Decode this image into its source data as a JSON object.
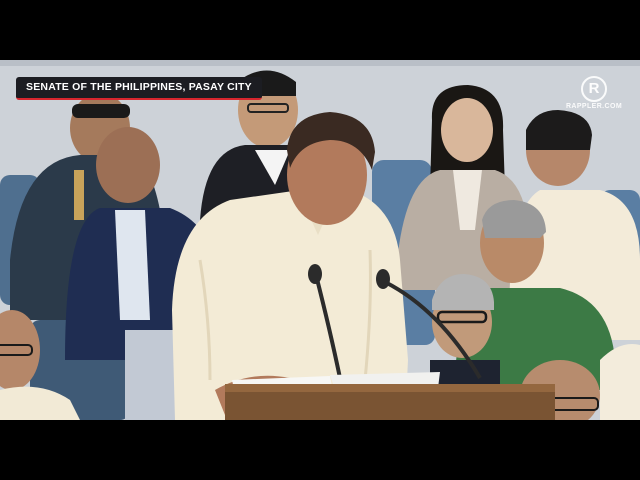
{
  "caption": {
    "location": "SENATE OF THE PHILIPPINES, PASAY CITY"
  },
  "watermark": {
    "brand": "RAPPLER.COM",
    "mark_letter": "R",
    "color": "#ffffff"
  },
  "colors": {
    "caption_bg": "#1c1d22",
    "caption_accent": "#d7262e",
    "wall": "#cfd3d8",
    "chairs": "#5d7fa0",
    "barong": "#f2ead6",
    "podium": "#7a5433"
  }
}
